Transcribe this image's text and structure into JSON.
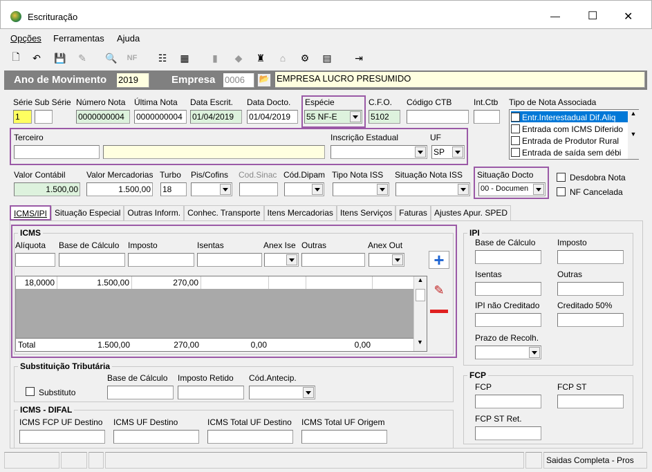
{
  "window": {
    "title": "Escrituração",
    "minimize": "—",
    "maximize": "☐",
    "close": "✕"
  },
  "menu": [
    "Opções",
    "Ferramentas",
    "Ajuda"
  ],
  "header": {
    "ano_label": "Ano de Movimento",
    "ano_value": "2019",
    "empresa_label": "Empresa",
    "empresa_code": "0006",
    "empresa_name": "EMPRESA LUCRO PRESUMIDO"
  },
  "nota": {
    "serie_label": "Série",
    "subserie_label": "Sub Série",
    "numero_label": "Número Nota",
    "ultima_label": "Última Nota",
    "data_escrit_label": "Data Escrit.",
    "data_docto_label": "Data Docto.",
    "especie_label": "Espécie",
    "cfo_label": "C.F.O.",
    "codigo_ctb_label": "Código CTB",
    "int_ctb_label": "Int.Ctb",
    "tipo_nota_label": "Tipo de Nota Associada",
    "serie": "1",
    "subserie": "",
    "numero": "0000000004",
    "ultima": "0000000004",
    "data_escrit": "01/04/2019",
    "data_docto": "01/04/2019",
    "especie": "55   NF-E",
    "cfo": "5102",
    "codigo_ctb": "",
    "int_ctb": ""
  },
  "tipo_nota_items": [
    "Entr.Interestadual Dif.Aliq",
    "Entrada com ICMS Diferido",
    "Entrada de Produtor Rural",
    "Entrada de saída sem débi"
  ],
  "terceiro": {
    "label": "Terceiro",
    "ie_label": "Inscrição Estadual",
    "uf_label": "UF",
    "uf_value": "SP"
  },
  "valores": {
    "valor_contabil_label": "Valor Contábil",
    "valor_contabil": "1.500,00",
    "valor_merc_label": "Valor Mercadorias",
    "valor_merc": "1.500,00",
    "turbo_label": "Turbo",
    "turbo": "18",
    "pis_label": "Pis/Cofins",
    "cod_sinac_label": "Cod.Sinac",
    "cod_dipam_label": "Cód.Dipam",
    "tipo_iss_label": "Tipo Nota ISS",
    "sit_iss_label": "Situação Nota ISS",
    "sit_docto_label": "Situação Docto",
    "sit_docto": "00 - Documen",
    "desdobra_label": "Desdobra Nota",
    "nf_cancelada_label": "NF Cancelada"
  },
  "tabs": [
    "ICMS/IPI",
    "Situação Especial",
    "Outras Inform.",
    "Conhec. Transporte",
    "Itens Mercadorias",
    "Itens Serviços",
    "Faturas",
    "Ajustes Apur. SPED"
  ],
  "icms": {
    "title": "ICMS",
    "aliquota_label": "Alíquota",
    "base_label": "Base de Cálculo",
    "imposto_label": "Imposto",
    "isentas_label": "Isentas",
    "anex_ise_label": "Anex Ise",
    "outras_label": "Outras",
    "anex_out_label": "Anex Out",
    "row": [
      "18,0000",
      "1.500,00",
      "270,00"
    ],
    "total": [
      "Total",
      "1.500,00",
      "270,00",
      "0,00",
      "0,00"
    ]
  },
  "ipi": {
    "title": "IPI",
    "base_label": "Base de Cálculo",
    "imposto_label": "Imposto",
    "isentas_label": "Isentas",
    "outras_label": "Outras",
    "nao_cred_label": "IPI não Creditado",
    "cred50_label": "Creditado 50%",
    "prazo_label": "Prazo de Recolh."
  },
  "st": {
    "title": "Substituição Tributária",
    "substituto_label": "Substituto",
    "base_label": "Base de Cálculo",
    "retido_label": "Imposto Retido",
    "antecip_label": "Cód.Antecip."
  },
  "difal": {
    "title": "ICMS - DIFAL",
    "fcp_label": "ICMS FCP UF Destino",
    "uf_dest_label": "ICMS UF Destino",
    "total_dest_label": "ICMS Total UF Destino",
    "total_orig_label": "ICMS Total UF Origem"
  },
  "fcp": {
    "title": "FCP",
    "fcp_label": "FCP",
    "fcp_st_label": "FCP ST",
    "fcp_st_ret_label": "FCP ST Ret."
  },
  "statusbar": {
    "right": "Saidas Completa - Pros"
  }
}
